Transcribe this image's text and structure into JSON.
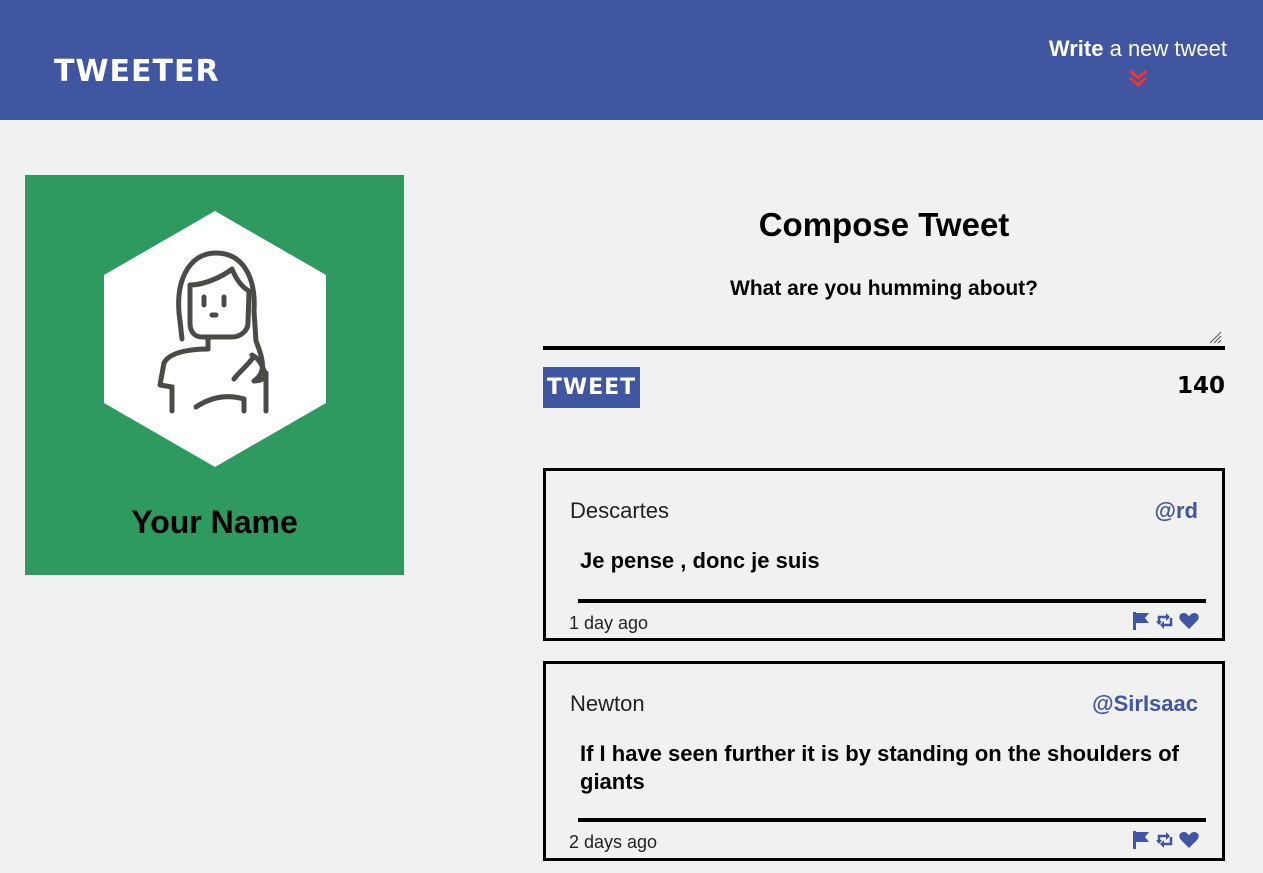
{
  "nav": {
    "brand": "TWEETER",
    "write_bold": "Write",
    "write_rest": " a new tweet"
  },
  "profile": {
    "name": "Your Name"
  },
  "compose": {
    "title": "Compose Tweet",
    "prompt": "What are you humming about?",
    "input_value": "",
    "button_label": "TWEET",
    "counter": "140"
  },
  "tweets": [
    {
      "name": "Descartes",
      "handle": "@rd",
      "text": "Je pense , donc je suis",
      "time": "1 day ago"
    },
    {
      "name": "Newton",
      "handle": "@SirIsaac",
      "text": "If I have seen further it is by standing on the shoulders of giants",
      "time": "2 days ago"
    }
  ],
  "colors": {
    "nav_bg": "#4056a1",
    "profile_bg": "#2e9a60",
    "accent": "#4056a1",
    "chevron": "#e8343a"
  },
  "icons": {
    "chevron": "double-chevron-down-icon",
    "flag": "flag-icon",
    "retweet": "retweet-icon",
    "like": "heart-icon"
  }
}
